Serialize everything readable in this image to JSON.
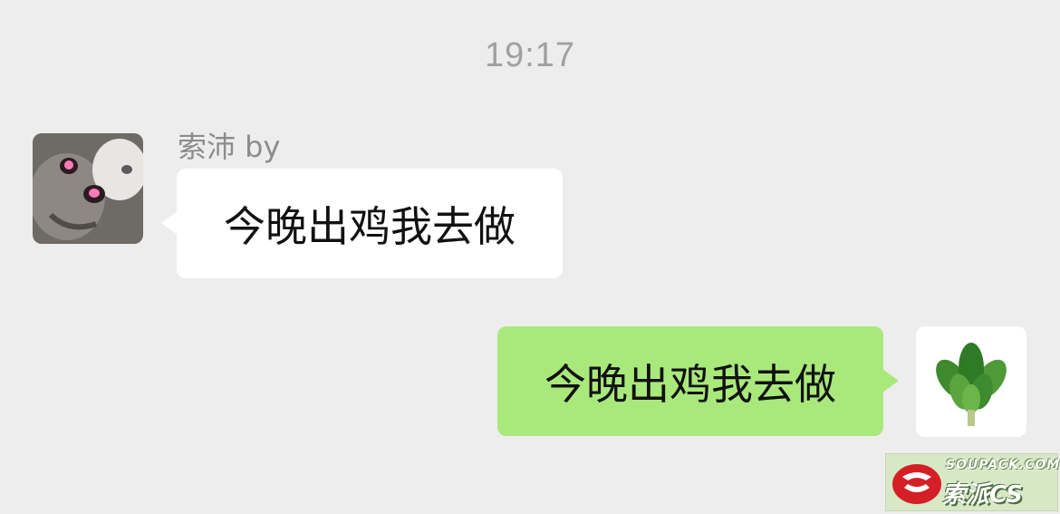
{
  "chat": {
    "timestamp": "19:17",
    "messages": [
      {
        "direction": "incoming",
        "sender_name": "索沛 by",
        "text": "今晚出鸡我去做",
        "avatar": "cat-photo-avatar"
      },
      {
        "direction": "outgoing",
        "text": "今晚出鸡我去做",
        "avatar": "leaf-bundle-avatar"
      }
    ]
  },
  "watermark": {
    "top_text": "SOUPACK.COM",
    "bottom_text": "索派CS",
    "logo": "red-s-logo"
  },
  "colors": {
    "background": "#ededed",
    "incoming_bubble": "#ffffff",
    "outgoing_bubble": "#a9e97b",
    "timestamp_text": "#a0a0a0",
    "sender_name_text": "#8c8c8c"
  }
}
